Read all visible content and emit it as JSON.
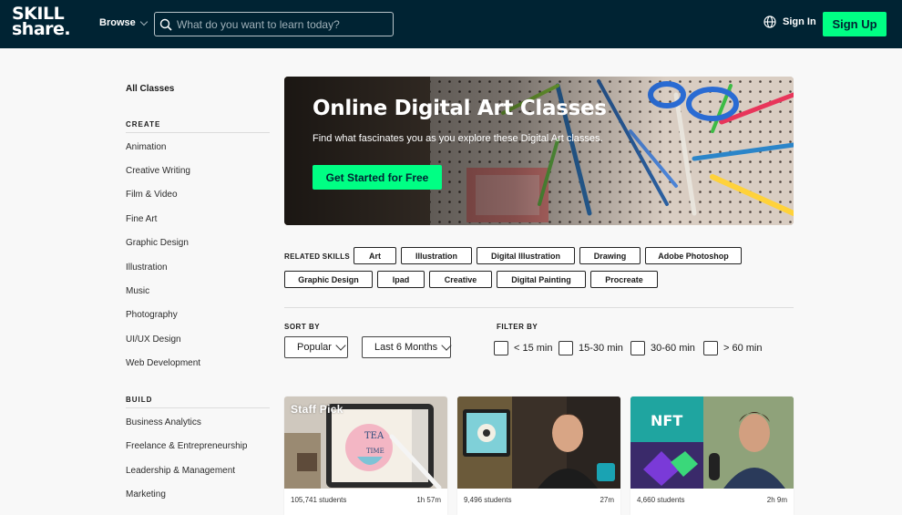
{
  "header": {
    "logo_line1": "SKILL",
    "logo_line2": "share.",
    "browse_label": "Browse",
    "search_placeholder": "What do you want to learn today?",
    "signin_label": "Sign In",
    "signup_label": "Sign Up"
  },
  "sidebar": {
    "all_classes": "All Classes",
    "create_title": "CREATE",
    "create_items": [
      "Animation",
      "Creative Writing",
      "Film & Video",
      "Fine Art",
      "Graphic Design",
      "Illustration",
      "Music",
      "Photography",
      "UI/UX Design",
      "Web Development"
    ],
    "build_title": "BUILD",
    "build_items": [
      "Business Analytics",
      "Freelance & Entrepreneurship",
      "Leadership & Management",
      "Marketing"
    ]
  },
  "hero": {
    "title": "Online Digital Art Classes",
    "subtitle": "Find what fascinates you as you explore these Digital Art classes.",
    "cta": "Get Started for Free"
  },
  "related_skills": {
    "label": "RELATED SKILLS",
    "row1": [
      "Art",
      "Illustration",
      "Digital Illustration",
      "Drawing",
      "Adobe Photoshop"
    ],
    "row2": [
      "Graphic Design",
      "Ipad",
      "Creative",
      "Digital Painting",
      "Procreate"
    ]
  },
  "sort": {
    "label": "SORT BY",
    "popular": "Popular",
    "period": "Last 6 Months"
  },
  "filter": {
    "label": "FILTER BY",
    "options": [
      "< 15 min",
      "15-30 min",
      "30-60 min",
      "> 60 min"
    ]
  },
  "cards": [
    {
      "badge": "Staff Pick",
      "students": "105,741 students",
      "duration": "1h 57m"
    },
    {
      "badge": "",
      "students": "9,496 students",
      "duration": "27m"
    },
    {
      "badge": "",
      "students": "4,660 students",
      "duration": "2h 9m"
    }
  ],
  "thumb_texts": {
    "tea": "TEA",
    "time": "TIME",
    "nft": "NFT"
  },
  "colors": {
    "header_bg": "#002333",
    "accent_green": "#00ff84"
  }
}
